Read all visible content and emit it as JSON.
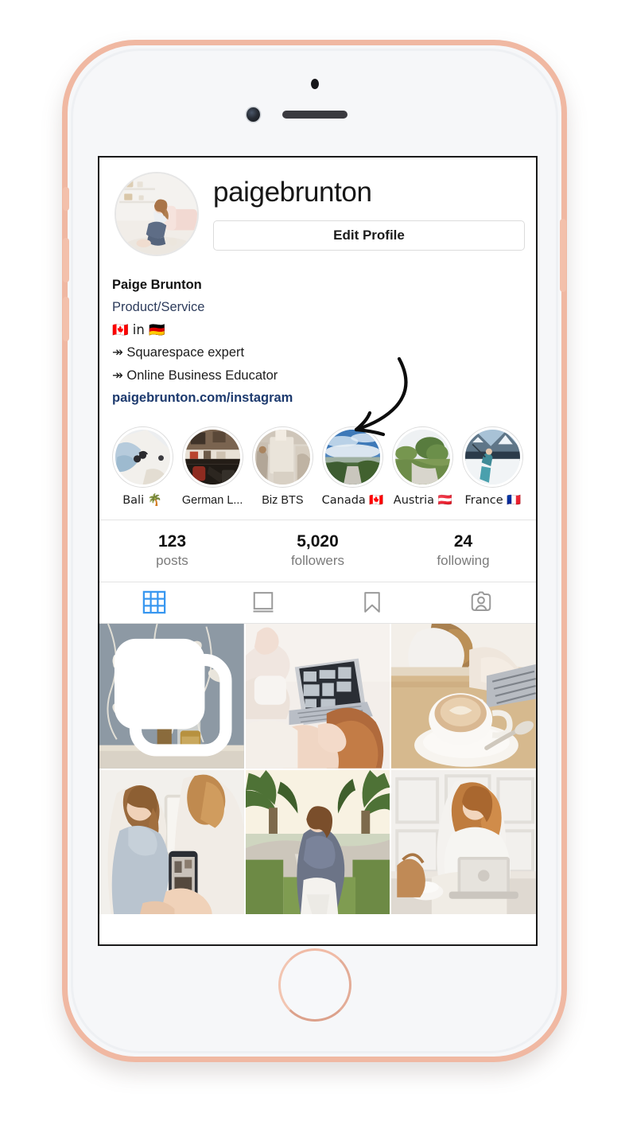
{
  "app": {
    "name": "Instagram",
    "device": "iPhone (rose gold)"
  },
  "profile": {
    "username": "paigebrunton",
    "edit_profile_label": "Edit Profile",
    "display_name": "Paige Brunton",
    "category": "Product/Service",
    "bio_lines": [
      "🇨🇦 in 🇩🇪",
      "↠ Squarespace expert",
      "↠ Online Business Educator"
    ],
    "website": "paigebrunton.com/instagram",
    "avatar_alt": "woman sitting on floor in bright living room"
  },
  "highlights": [
    {
      "label": "Bali 🌴",
      "alt": "denim and linen flatlay"
    },
    {
      "label": "German L...",
      "alt": "desk with camera gear and red bag"
    },
    {
      "label": "Biz BTS",
      "alt": "behind the scenes studio shot"
    },
    {
      "label": "Canada 🇨🇦",
      "alt": "open road under cloudy sky"
    },
    {
      "label": "Austria 🇦🇹",
      "alt": "green countryside path"
    },
    {
      "label": "France 🇫🇷",
      "alt": "person on snowy slope"
    }
  ],
  "stats": [
    {
      "value": "123",
      "label": "posts"
    },
    {
      "value": "5,020",
      "label": "followers"
    },
    {
      "value": "24",
      "label": "following"
    }
  ],
  "tabs": [
    {
      "icon": "grid-icon",
      "name": "grid",
      "active": true
    },
    {
      "icon": "feed-icon",
      "name": "feed",
      "active": false
    },
    {
      "icon": "bookmark-icon",
      "name": "saved",
      "active": false
    },
    {
      "icon": "tagged-icon",
      "name": "tagged",
      "active": false
    }
  ],
  "posts": [
    {
      "alt": "chinoiserie wallpaper with perfume bottles",
      "badge": "carousel-icon"
    },
    {
      "alt": "woman lying down with laptop open",
      "badge": null
    },
    {
      "alt": "latte cup beside laptop and hands typing",
      "badge": null
    },
    {
      "alt": "woman being photographed on a phone",
      "badge": null
    },
    {
      "alt": "woman posing on palm-lined walkway",
      "badge": null
    },
    {
      "alt": "woman working on laptop at white table",
      "badge": null
    }
  ],
  "annotation": {
    "type": "hand-drawn-arrow",
    "points_to": "paigebrunton.com/instagram"
  },
  "colors": {
    "accent_blue": "#3897f0",
    "link_navy": "#1d3a6e",
    "category_navy": "#2d3c5c",
    "device_frame": "#f0b8a2",
    "muted_text": "#7b7b7b",
    "divider": "#e4e4e4"
  }
}
